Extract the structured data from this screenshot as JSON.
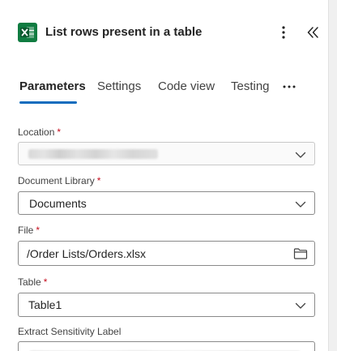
{
  "header": {
    "title": "List rows present in a table",
    "app_icon": "excel-icon",
    "brand_color": "#107c41"
  },
  "tabs": [
    {
      "label": "Parameters",
      "active": true
    },
    {
      "label": "Settings",
      "active": false
    },
    {
      "label": "Code view",
      "active": false
    },
    {
      "label": "Testing",
      "active": false
    }
  ],
  "accent_color": "#0f6cbd",
  "fields": {
    "location": {
      "label": "Location",
      "required_mark": "*"
    },
    "document_library": {
      "label": "Document Library",
      "required_mark": "*",
      "value": "Documents"
    },
    "file": {
      "label": "File",
      "required_mark": "*",
      "value": "/Order Lists/Orders.xlsx"
    },
    "table": {
      "label": "Table",
      "required_mark": "*",
      "value": "Table1"
    },
    "extract_sensitivity_label": {
      "label": "Extract Sensitivity Label"
    }
  },
  "icons": {
    "more": "more-vertical-icon",
    "collapse": "double-chevron-left-icon",
    "tab_more": "more-horizontal-icon",
    "dropdown": "chevron-down-icon",
    "folder": "folder-icon"
  }
}
